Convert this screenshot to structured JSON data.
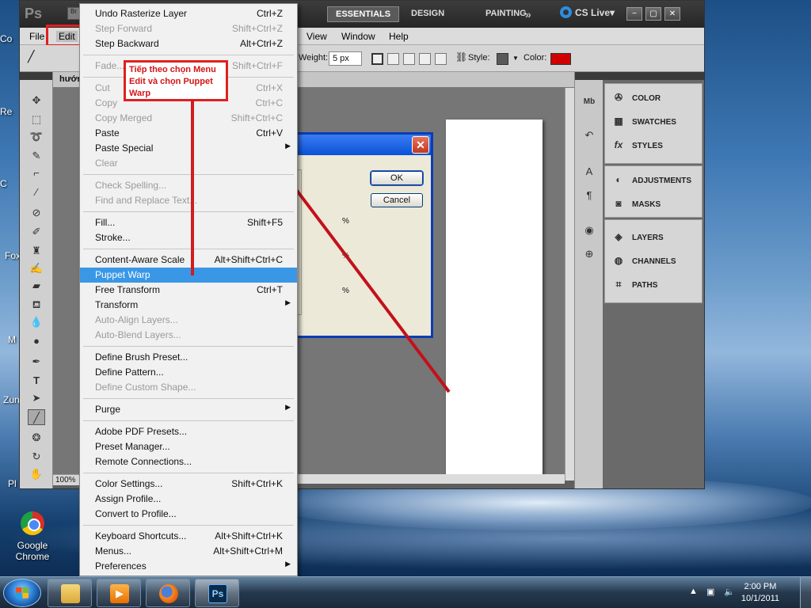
{
  "app": {
    "logo": "Ps",
    "bridge_label": "Br",
    "workspaces": [
      "ESSENTIALS",
      "DESIGN",
      "PAINTING"
    ],
    "more_glyph": "»",
    "cs_live": "CS Live▾",
    "window_controls": [
      "−",
      "▢",
      "✕"
    ]
  },
  "menubar": [
    "File",
    "Edit",
    "View",
    "Window",
    "Help"
  ],
  "options": {
    "weight_label": "Weight:",
    "weight_value": "5 px",
    "style_label": "Style:",
    "color_label": "Color:",
    "color_value": "#d00000"
  },
  "document": {
    "tab_title": "hướn",
    "zoom": "100%"
  },
  "dialog": {
    "ok": "OK",
    "cancel": "Cancel",
    "pct": [
      "%",
      "%",
      "%"
    ]
  },
  "edit_menu": [
    {
      "label": "Undo Rasterize Layer",
      "shortcut": "Ctrl+Z",
      "disabled": false
    },
    {
      "label": "Step Forward",
      "shortcut": "Shift+Ctrl+Z",
      "disabled": true
    },
    {
      "label": "Step Backward",
      "shortcut": "Alt+Ctrl+Z",
      "disabled": false
    },
    {
      "sep": true
    },
    {
      "label": "Fade...",
      "shortcut": "Shift+Ctrl+F",
      "disabled": true
    },
    {
      "sep": true
    },
    {
      "label": "Cut",
      "shortcut": "Ctrl+X",
      "disabled": true
    },
    {
      "label": "Copy",
      "shortcut": "Ctrl+C",
      "disabled": true
    },
    {
      "label": "Copy Merged",
      "shortcut": "Shift+Ctrl+C",
      "disabled": true
    },
    {
      "label": "Paste",
      "shortcut": "Ctrl+V",
      "disabled": false
    },
    {
      "label": "Paste Special",
      "submenu": true,
      "disabled": false
    },
    {
      "label": "Clear",
      "disabled": true
    },
    {
      "sep": true
    },
    {
      "label": "Check Spelling...",
      "disabled": true
    },
    {
      "label": "Find and Replace Text...",
      "disabled": true
    },
    {
      "sep": true
    },
    {
      "label": "Fill...",
      "shortcut": "Shift+F5",
      "disabled": false
    },
    {
      "label": "Stroke...",
      "disabled": false
    },
    {
      "sep": true
    },
    {
      "label": "Content-Aware Scale",
      "shortcut": "Alt+Shift+Ctrl+C",
      "disabled": false
    },
    {
      "label": "Puppet Warp",
      "disabled": false,
      "highlighted": true
    },
    {
      "label": "Free Transform",
      "shortcut": "Ctrl+T",
      "disabled": false
    },
    {
      "label": "Transform",
      "submenu": true,
      "disabled": false
    },
    {
      "label": "Auto-Align Layers...",
      "disabled": true
    },
    {
      "label": "Auto-Blend Layers...",
      "disabled": true
    },
    {
      "sep": true
    },
    {
      "label": "Define Brush Preset...",
      "disabled": false
    },
    {
      "label": "Define Pattern...",
      "disabled": false
    },
    {
      "label": "Define Custom Shape...",
      "disabled": true
    },
    {
      "sep": true
    },
    {
      "label": "Purge",
      "submenu": true,
      "disabled": false
    },
    {
      "sep": true
    },
    {
      "label": "Adobe PDF Presets...",
      "disabled": false
    },
    {
      "label": "Preset Manager...",
      "disabled": false
    },
    {
      "label": "Remote Connections...",
      "disabled": false
    },
    {
      "sep": true
    },
    {
      "label": "Color Settings...",
      "shortcut": "Shift+Ctrl+K",
      "disabled": false
    },
    {
      "label": "Assign Profile...",
      "disabled": false
    },
    {
      "label": "Convert to Profile...",
      "disabled": false
    },
    {
      "sep": true
    },
    {
      "label": "Keyboard Shortcuts...",
      "shortcut": "Alt+Shift+Ctrl+K",
      "disabled": false
    },
    {
      "label": "Menus...",
      "shortcut": "Alt+Shift+Ctrl+M",
      "disabled": false
    },
    {
      "label": "Preferences",
      "submenu": true,
      "disabled": false
    }
  ],
  "callout": "Tiếp theo chọn Menu Edit và chọn Puppet Warp",
  "panels": {
    "group1": [
      "COLOR",
      "SWATCHES",
      "STYLES"
    ],
    "group2": [
      "ADJUSTMENTS",
      "MASKS"
    ],
    "group3": [
      "LAYERS",
      "CHANNELS",
      "PATHS"
    ]
  },
  "desktop": {
    "side_labels": [
      "Co",
      "Re",
      "C",
      "Fox",
      "M",
      "Zun",
      "Pl"
    ],
    "chrome_label": "Google Chrome"
  },
  "taskbar": {
    "time": "2:00 PM",
    "date": "10/1/2011",
    "ps_label": "Ps"
  }
}
